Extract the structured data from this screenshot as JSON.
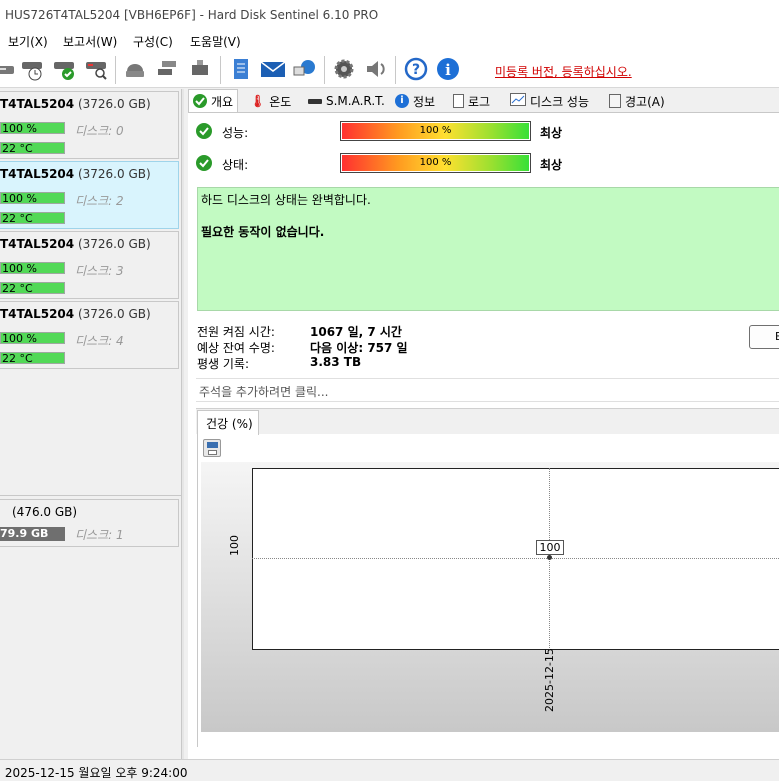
{
  "window": {
    "title": "HUS726T4TAL5204 [VBH6EP6F]  -  Hard Disk Sentinel 6.10 PRO"
  },
  "menu": {
    "items": [
      "보기(X)",
      "보고서(W)",
      "구성(C)",
      "도움말(V)"
    ]
  },
  "toolbar": {
    "unregistered": "미등록 버전, 등록하십시오.",
    "icons": [
      "disk-icon",
      "disk-clock-icon",
      "disk-check-icon",
      "disk-search-icon",
      "drive-icon",
      "network-drive-icon",
      "usb-drive-icon",
      "report-icon",
      "mail-icon",
      "network-icon",
      "gear-icon",
      "speaker-icon",
      "help-icon",
      "info-icon"
    ]
  },
  "disks": [
    {
      "name_bold": "T4TAL5204",
      "size": "(3726.0 GB)",
      "health": "100 %",
      "temp": "22 °C",
      "label": "디스크: 0"
    },
    {
      "name_bold": "T4TAL5204",
      "size": "(3726.0 GB)",
      "health": "100 %",
      "temp": "22 °C",
      "label": "디스크: 2"
    },
    {
      "name_bold": "T4TAL5204",
      "size": "(3726.0 GB)",
      "health": "100 %",
      "temp": "22 °C",
      "label": "디스크: 3"
    },
    {
      "name_bold": "T4TAL5204",
      "size": "(3726.0 GB)",
      "health": "100 %",
      "temp": "22 °C",
      "label": "디스크: 4"
    }
  ],
  "volume": {
    "size": "(476.0 GB)",
    "free": "79.9 GB",
    "label": "디스크: 1"
  },
  "tabs": [
    "개요",
    "온도",
    "S.M.A.R.T.",
    "정보",
    "로그",
    "디스크 성능",
    "경고(A)"
  ],
  "overview": {
    "performance_label": "성능:",
    "performance_value": "100 %",
    "performance_rating": "최상",
    "health_label": "상태:",
    "health_value": "100 %",
    "health_rating": "최상",
    "status_text": "하드 디스크의 상태는 완벽합니다.",
    "action_text": "필요한 동작이 없습니다.",
    "power_on_label": "전원 켜짐 시간:",
    "power_on_value": "1067 일, 7 시간",
    "lifetime_label": "예상 잔여 수명:",
    "lifetime_value": "다음 이상: 757 일",
    "written_label": "평생 기록:",
    "written_value": "3.83 TB",
    "button_label": "E",
    "note_placeholder": "주석을 추가하려면 클릭..."
  },
  "chart_data": {
    "type": "line",
    "tab_title": "건강 (%)",
    "x": [
      "2025-12-15"
    ],
    "series": [
      {
        "values": [
          100
        ]
      }
    ],
    "ytick_labels": [
      "100"
    ],
    "xtick_labels": [
      "2025-12-15"
    ],
    "data_labels": [
      "100"
    ]
  },
  "statusbar": {
    "text": ": 2025-12-15 월요일 오후 9:24:00"
  }
}
